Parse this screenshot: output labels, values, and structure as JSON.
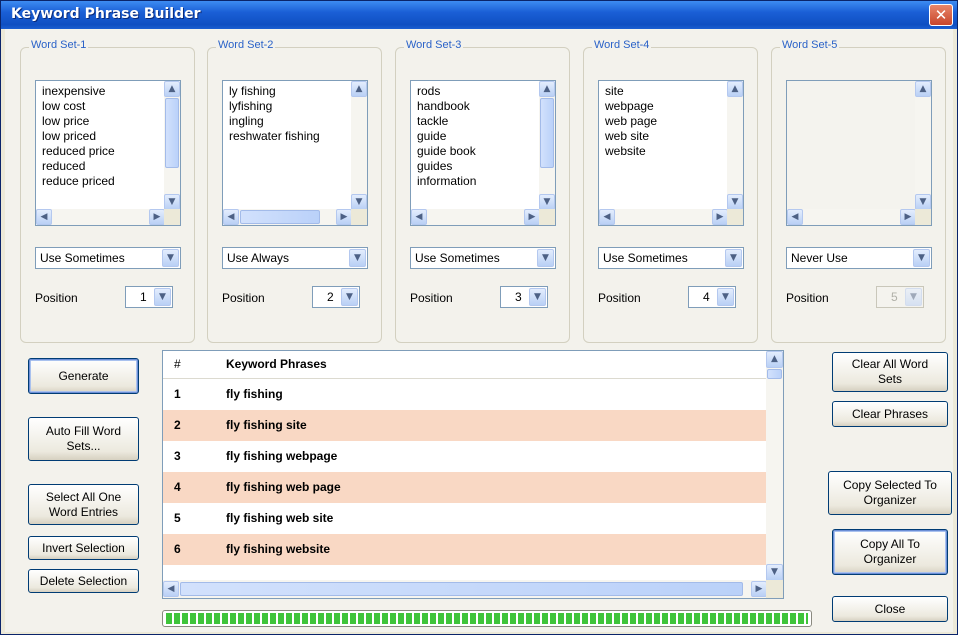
{
  "window": {
    "title": "Keyword Phrase Builder"
  },
  "word_sets": [
    {
      "label": "Word Set-1",
      "items": [
        "inexpensive",
        "low cost",
        "low price",
        "low priced",
        "reduced price",
        "reduced",
        "reduce priced"
      ],
      "usage": "Use Sometimes",
      "position_label": "Position",
      "position": "1",
      "enabled": true
    },
    {
      "label": "Word Set-2",
      "items": [
        "ly fishing",
        "lyfishing",
        "ingling",
        "reshwater fishing"
      ],
      "usage": "Use Always",
      "position_label": "Position",
      "position": "2",
      "enabled": true
    },
    {
      "label": "Word Set-3",
      "items": [
        "rods",
        "handbook",
        "tackle",
        "guide",
        "guide book",
        "guides",
        "information"
      ],
      "usage": "Use Sometimes",
      "position_label": "Position",
      "position": "3",
      "enabled": true
    },
    {
      "label": "Word Set-4",
      "items": [
        "site",
        "webpage",
        "web page",
        "web site",
        "website"
      ],
      "usage": "Use Sometimes",
      "position_label": "Position",
      "position": "4",
      "enabled": true
    },
    {
      "label": "Word Set-5",
      "items": [],
      "usage": "Never Use",
      "position_label": "Position",
      "position": "5",
      "enabled": false
    }
  ],
  "left_buttons": {
    "generate": "Generate",
    "auto_fill": "Auto Fill Word Sets...",
    "select_all_one": "Select All One Word Entries",
    "invert": "Invert Selection",
    "delete": "Delete Selection"
  },
  "phrases": {
    "header_num": "#",
    "header_phrase": "Keyword Phrases",
    "rows": [
      {
        "num": "1",
        "phrase": "fly fishing"
      },
      {
        "num": "2",
        "phrase": "fly fishing site"
      },
      {
        "num": "3",
        "phrase": "fly fishing webpage"
      },
      {
        "num": "4",
        "phrase": "fly fishing web page"
      },
      {
        "num": "5",
        "phrase": "fly fishing web site"
      },
      {
        "num": "6",
        "phrase": "fly fishing website"
      }
    ]
  },
  "right_buttons": {
    "clear_all": "Clear All Word Sets",
    "clear_phrases": "Clear Phrases",
    "copy_selected": "Copy Selected To Organizer",
    "copy_all": "Copy All To Organizer",
    "close": "Close"
  },
  "progress": {
    "fraction": 1.0
  },
  "colors": {
    "title_bar": "#1a5fd6",
    "alt_row": "#f9d8c4",
    "group_label": "#2a62c8",
    "progress": "#3fc43a"
  },
  "icons": {
    "close": "close-icon",
    "scroll_up": "scroll-up-icon",
    "scroll_down": "scroll-down-icon",
    "scroll_left": "scroll-left-icon",
    "scroll_right": "scroll-right-icon",
    "dropdown": "chevron-down-icon"
  }
}
